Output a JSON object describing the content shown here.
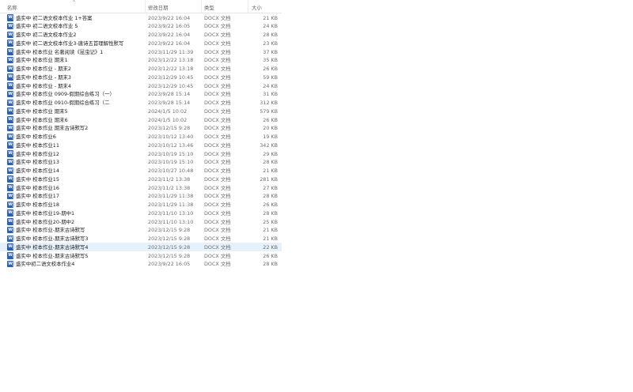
{
  "columns": {
    "name": "名称",
    "modified": "修改日期",
    "type": "类型",
    "size": "大小",
    "sort_glyph": "^"
  },
  "files": [
    {
      "name": "盛实中 初二语文校本作业 1+答案",
      "date": "2023/9/22 16:04",
      "type": "DOCX 文档",
      "size": "21 KB"
    },
    {
      "name": "盛实中 初二语文校本作业 5",
      "date": "2023/9/22 16:05",
      "type": "DOCX 文档",
      "size": "24 KB"
    },
    {
      "name": "盛实中 初二语文校本作业2",
      "date": "2023/9/22 16:04",
      "type": "DOCX 文档",
      "size": "28 KB"
    },
    {
      "name": "盛实中 初二语文校本作业3-唐诗五首理解性默写",
      "date": "2023/9/22 16:04",
      "type": "DOCX 文档",
      "size": "23 KB"
    },
    {
      "name": "盛实中 校本作业 名著阅读《昆虫记》1",
      "date": "2023/11/29 11:39",
      "type": "DOCX 文档",
      "size": "37 KB"
    },
    {
      "name": "盛实中 校本作业 期末1",
      "date": "2023/12/22 13:18",
      "type": "DOCX 文档",
      "size": "35 KB"
    },
    {
      "name": "盛实中 校本作业 - 期末2",
      "date": "2023/12/22 13:18",
      "type": "DOCX 文档",
      "size": "26 KB"
    },
    {
      "name": "盛实中 校本作业 - 期末3",
      "date": "2023/12/29 10:45",
      "type": "DOCX 文档",
      "size": "59 KB"
    },
    {
      "name": "盛实中 校本作业 - 期末4",
      "date": "2023/12/29 10:45",
      "type": "DOCX 文档",
      "size": "24 KB"
    },
    {
      "name": "盛实中 校本作业 0909-假期综合练习（一）",
      "date": "2023/9/28 15:14",
      "type": "DOCX 文档",
      "size": "31 KB"
    },
    {
      "name": "盛实中 校本作业 0910-假期综合练习（二",
      "date": "2023/9/28 15:14",
      "type": "DOCX 文档",
      "size": "312 KB"
    },
    {
      "name": "盛实中 校本作业 期末5",
      "date": "2024/1/5 10:02",
      "type": "DOCX 文档",
      "size": "579 KB"
    },
    {
      "name": "盛实中 校本作业 期末6",
      "date": "2024/1/5 10:02",
      "type": "DOCX 文档",
      "size": "26 KB"
    },
    {
      "name": "盛实中 校本作业 期末古诗默写2",
      "date": "2023/12/15 9:28",
      "type": "DOCX 文档",
      "size": "20 KB"
    },
    {
      "name": "盛实中 校本作业6",
      "date": "2023/10/12 13:40",
      "type": "DOCX 文档",
      "size": "19 KB"
    },
    {
      "name": "盛实中 校本作业11",
      "date": "2023/10/12 13:46",
      "type": "DOCX 文档",
      "size": "342 KB"
    },
    {
      "name": "盛实中 校本作业12",
      "date": "2023/10/19 15:10",
      "type": "DOCX 文档",
      "size": "29 KB"
    },
    {
      "name": "盛实中 校本作业13",
      "date": "2023/10/19 15:10",
      "type": "DOCX 文档",
      "size": "28 KB"
    },
    {
      "name": "盛实中 校本作业14",
      "date": "2023/10/27 10:48",
      "type": "DOCX 文档",
      "size": "21 KB"
    },
    {
      "name": "盛实中 校本作业15",
      "date": "2023/11/2 13:38",
      "type": "DOCX 文档",
      "size": "281 KB"
    },
    {
      "name": "盛实中 校本作业16",
      "date": "2023/11/2 13:38",
      "type": "DOCX 文档",
      "size": "27 KB"
    },
    {
      "name": "盛实中 校本作业17",
      "date": "2023/11/29 11:38",
      "type": "DOCX 文档",
      "size": "28 KB"
    },
    {
      "name": "盛实中 校本作业18",
      "date": "2023/11/29 11:38",
      "type": "DOCX 文档",
      "size": "26 KB"
    },
    {
      "name": "盛实中 校本作业19-期中1",
      "date": "2023/11/10 13:10",
      "type": "DOCX 文档",
      "size": "28 KB"
    },
    {
      "name": "盛实中 校本作业20-期中2",
      "date": "2023/11/10 13:10",
      "type": "DOCX 文档",
      "size": "25 KB"
    },
    {
      "name": "盛实中 校本作业-期末古诗默写",
      "date": "2023/12/15 9:28",
      "type": "DOCX 文档",
      "size": "21 KB"
    },
    {
      "name": "盛实中 校本作业-期末古诗默写3",
      "date": "2023/12/15 9:28",
      "type": "DOCX 文档",
      "size": "21 KB"
    },
    {
      "name": "盛实中 校本作业-期末古诗默写4",
      "date": "2023/12/15 9:28",
      "type": "DOCX 文档",
      "size": "22 KB",
      "selected": true
    },
    {
      "name": "盛实中 校本作业-期末古诗默写5",
      "date": "2023/12/15 9:28",
      "type": "DOCX 文档",
      "size": "26 KB"
    },
    {
      "name": "盛实中初二语文校本作业4",
      "date": "2023/9/22 16:05",
      "type": "DOCX 文档",
      "size": "28 KB"
    }
  ],
  "icons": {
    "file": "word-document-icon",
    "file_glyph": "W"
  },
  "colors": {
    "selected_row": "#e5f1fb",
    "word_blue": "#2b5fb8"
  }
}
